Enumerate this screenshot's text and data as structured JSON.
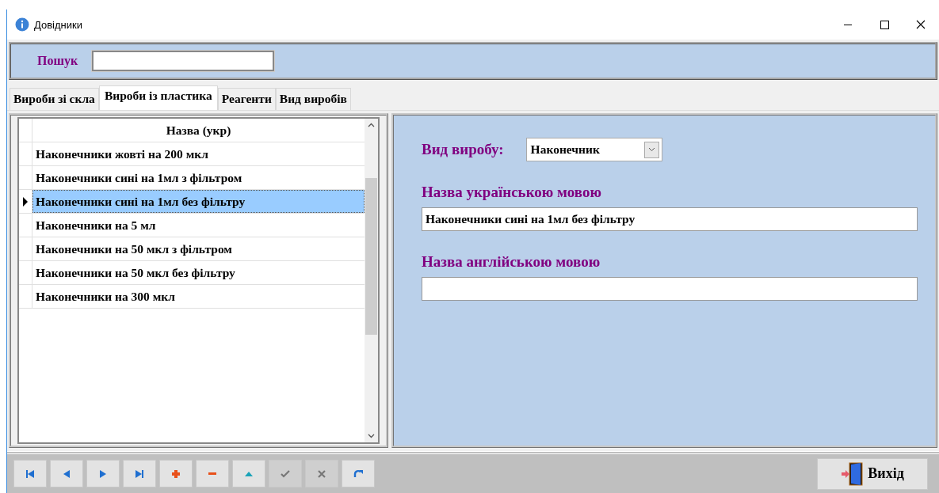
{
  "window": {
    "title": "Довідники"
  },
  "search": {
    "label": "Пошук"
  },
  "tabs": [
    {
      "label": "Вироби зі скла",
      "selected": false
    },
    {
      "label": "Вироби із пластика",
      "selected": true
    },
    {
      "label": "Реагенти",
      "selected": false
    },
    {
      "label": "Вид виробів",
      "selected": false
    }
  ],
  "table": {
    "columns": [
      "Назва (укр)"
    ],
    "rows": [
      {
        "name": "Наконечники жовті на 200 мкл",
        "selected": false
      },
      {
        "name": "Наконечники сині на 1мл з фільтром",
        "selected": false
      },
      {
        "name": "Наконечники сині на 1мл без фільтру",
        "selected": true
      },
      {
        "name": "Наконечники на 5 мл",
        "selected": false
      },
      {
        "name": "Наконечники на 50 мкл з фільтром",
        "selected": false
      },
      {
        "name": "Наконечники на 50 мкл без фільтру",
        "selected": false
      },
      {
        "name": "Наконечники на 300 мкл",
        "selected": false
      }
    ]
  },
  "form": {
    "type_label": "Вид виробу:",
    "type_value": "Наконечник",
    "ukr_label": "Назва українською мовою",
    "ukr_value": "Наконечники сині на 1мл без фільтру",
    "eng_label": "Назва англійською мовою"
  },
  "toolbar": [
    {
      "kind": "first",
      "disabled": false
    },
    {
      "kind": "prior",
      "disabled": false
    },
    {
      "kind": "next",
      "disabled": false
    },
    {
      "kind": "last",
      "disabled": false
    },
    {
      "kind": "insert",
      "disabled": false
    },
    {
      "kind": "delete",
      "disabled": false
    },
    {
      "kind": "edit",
      "disabled": false
    },
    {
      "kind": "post",
      "disabled": true
    },
    {
      "kind": "cancel",
      "disabled": true
    },
    {
      "kind": "refresh",
      "disabled": false
    }
  ],
  "exit_button": {
    "label": "Вихід"
  }
}
